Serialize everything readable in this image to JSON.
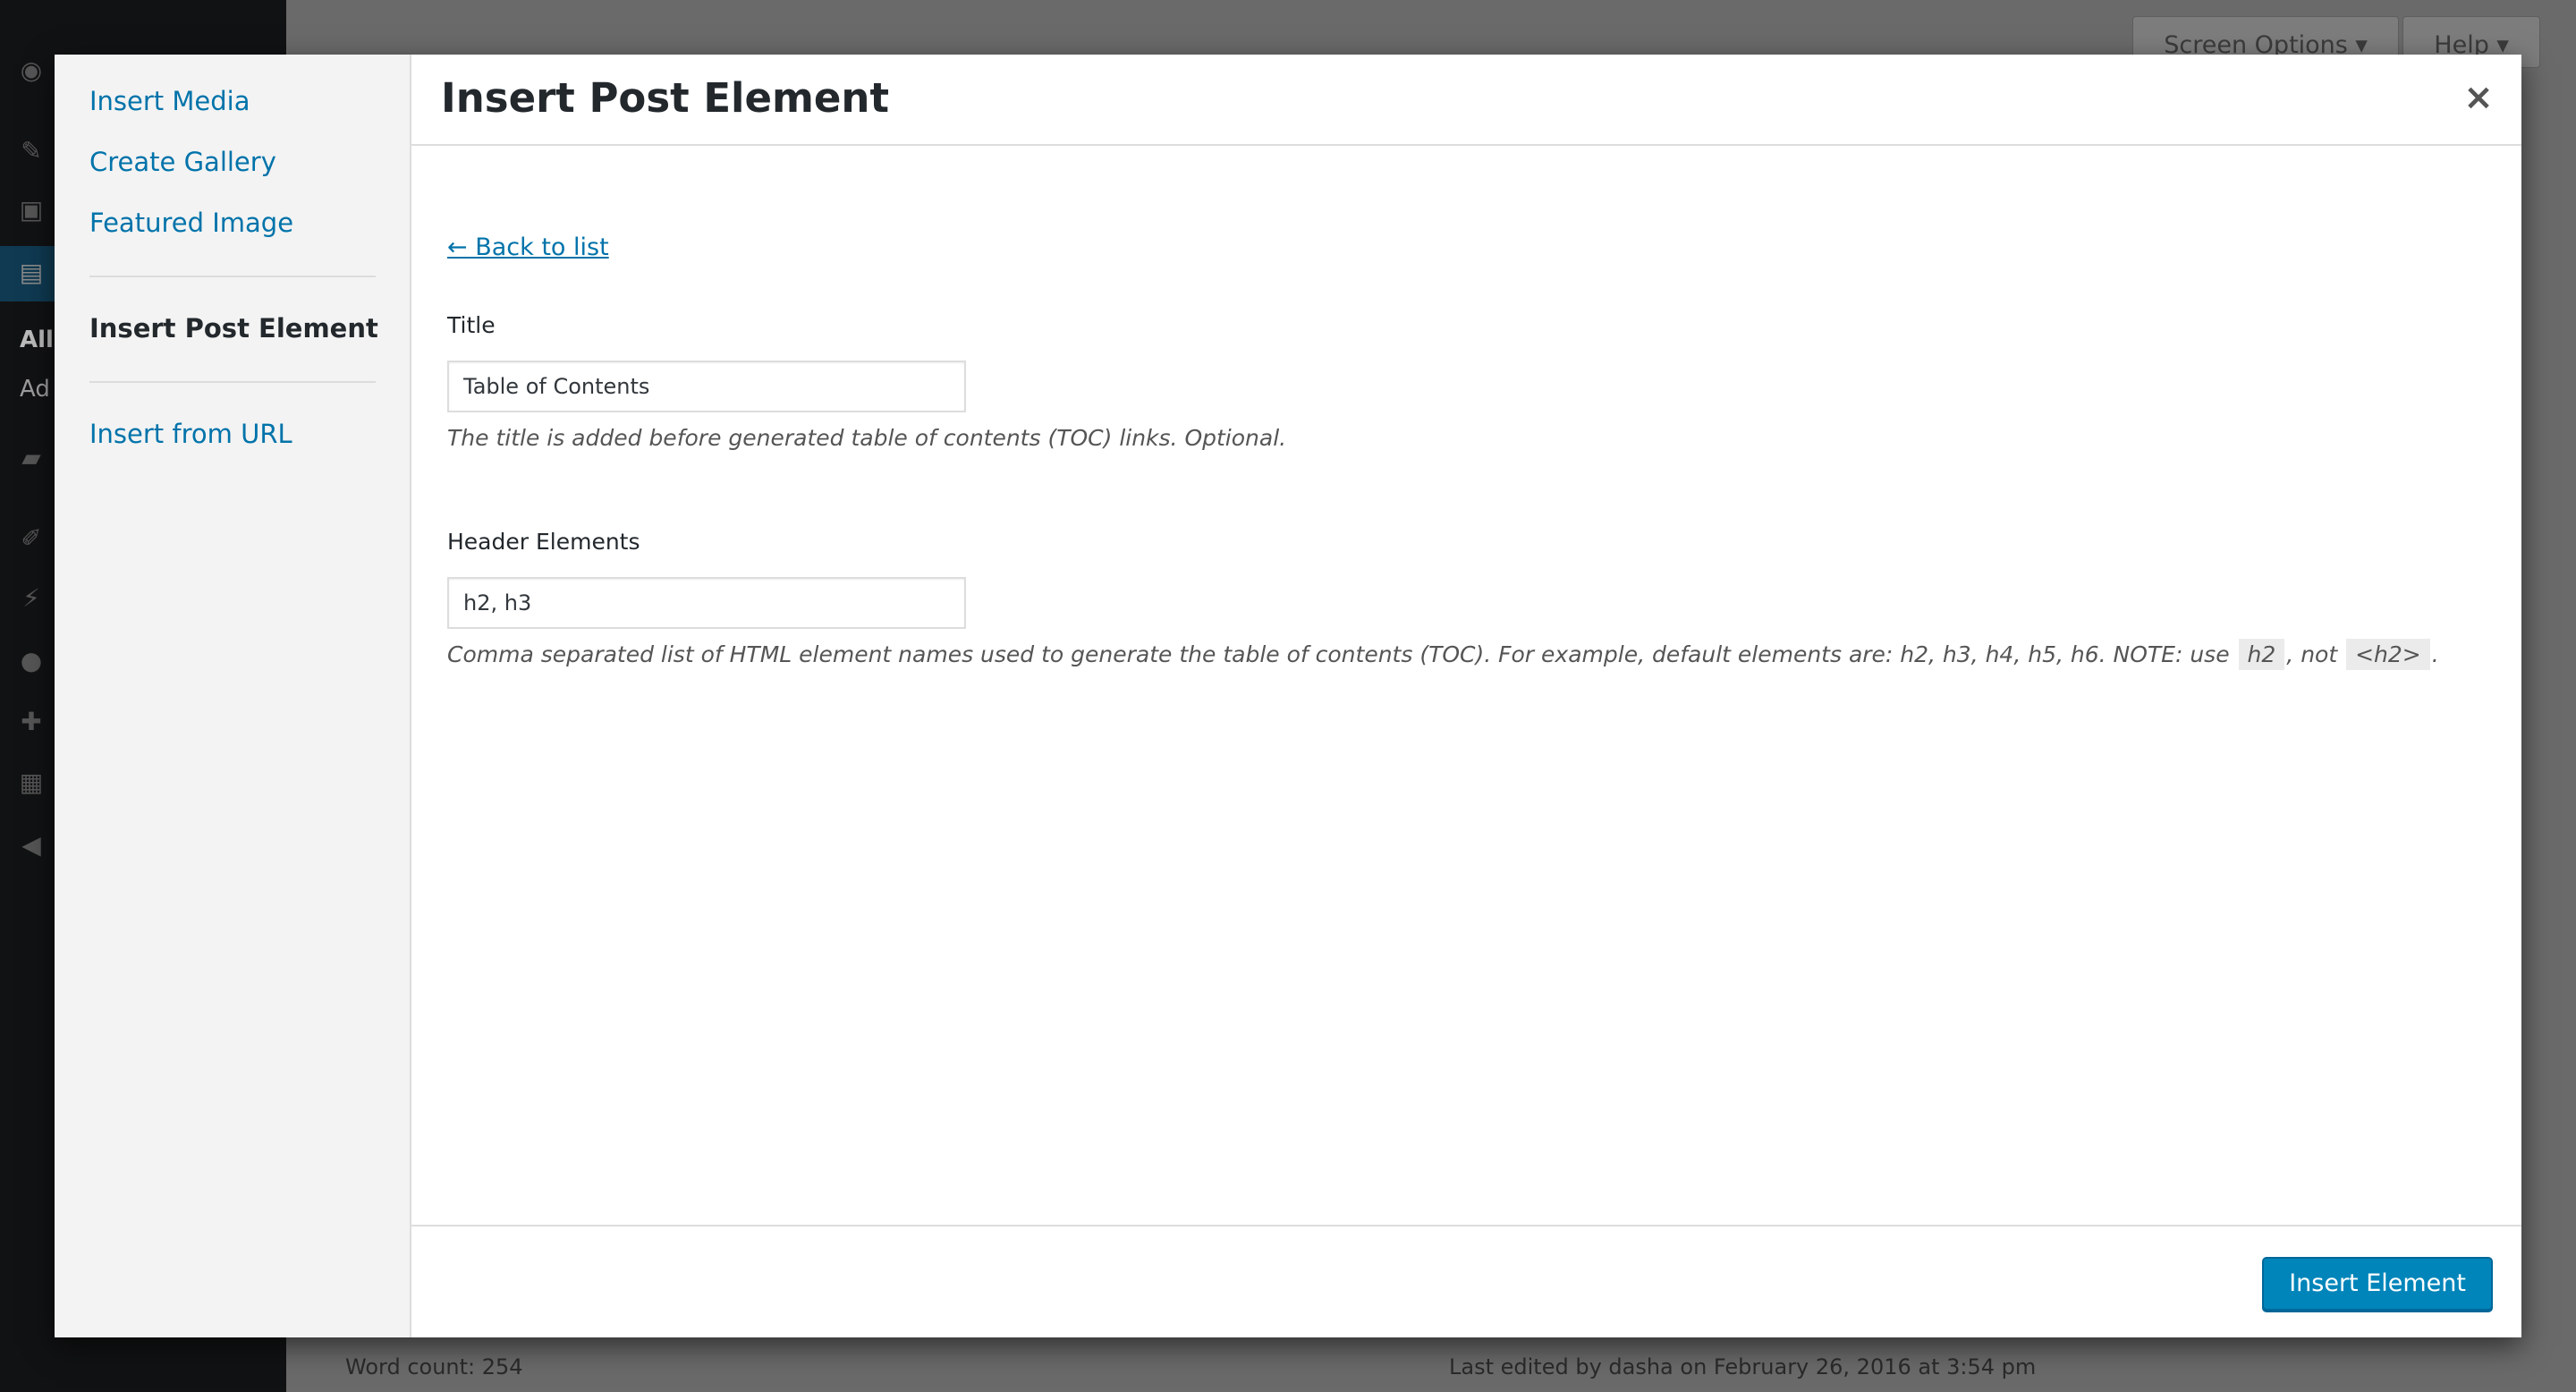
{
  "background": {
    "menu_partial_labels": [
      "All",
      "Ad"
    ],
    "screen_options_label": "Screen Options ▾",
    "help_label": "Help ▾",
    "footer": {
      "word_count": "Word count: 254",
      "last_edited": "Last edited by dasha on February 26, 2016 at 3:54 pm"
    },
    "icons": [
      "dashboard-icon",
      "pin-icon",
      "media-icon",
      "pages-icon",
      "comments-icon",
      "appearance-icon",
      "plugins-icon",
      "users-icon",
      "tools-icon",
      "settings-icon",
      "collapse-icon"
    ]
  },
  "modal": {
    "menu": {
      "items": [
        {
          "label": "Insert Media"
        },
        {
          "label": "Create Gallery"
        },
        {
          "label": "Featured Image"
        },
        {
          "label": "Insert Post Element"
        },
        {
          "label": "Insert from URL"
        }
      ],
      "active_index": 3
    },
    "title": "Insert Post Element",
    "close_icon": "×",
    "back_link": "← Back to list",
    "fields": {
      "title": {
        "label": "Title",
        "value": "Table of Contents",
        "description": "The title is added before generated table of contents (TOC) links. Optional."
      },
      "header_elements": {
        "label": "Header Elements",
        "value": "h2, h3",
        "description_prefix": "Comma separated list of HTML element names used to generate the table of contents (TOC). For example, default elements are: h2, h3, h4, h5, h6. NOTE: use",
        "code_1": "h2",
        "description_middle": ", not",
        "code_2": "<h2>",
        "description_suffix": "."
      }
    },
    "insert_button": "Insert Element"
  },
  "colors": {
    "link": "#0073aa",
    "primary_button": "#0085ba",
    "admin_menu": "#111213"
  }
}
